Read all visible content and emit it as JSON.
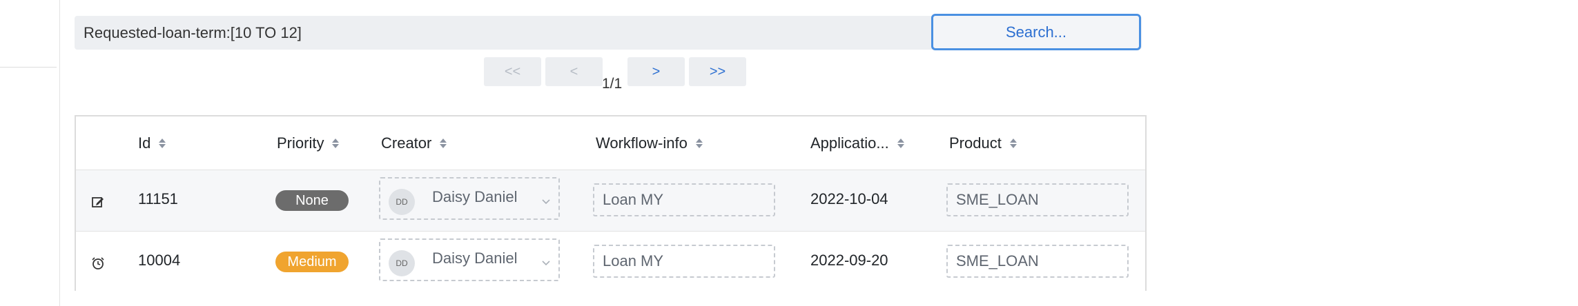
{
  "search": {
    "query": "Requested-loan-term:[10 TO 12]",
    "button_label": "Search..."
  },
  "pagination": {
    "first": "<<",
    "prev": "<",
    "next": ">",
    "last": ">>",
    "indicator": "1/1"
  },
  "table": {
    "columns": {
      "id": "Id",
      "priority": "Priority",
      "creator": "Creator",
      "workflow": "Workflow-info",
      "application": "Applicatio...",
      "product": "Product"
    },
    "rows": [
      {
        "icon": "edit-icon",
        "id": "11151",
        "priority": "None",
        "priority_color": "#6c6c6c",
        "creator_initials": "DD",
        "creator_name": "Daisy Daniel",
        "workflow": "Loan MY",
        "application_date": "2022-10-04",
        "product": "SME_LOAN"
      },
      {
        "icon": "alarm-clock-icon",
        "id": "10004",
        "priority": "Medium",
        "priority_color": "#f0a42f",
        "creator_initials": "DD",
        "creator_name": "Daisy Daniel",
        "workflow": "Loan MY",
        "application_date": "2022-09-20",
        "product": "SME_LOAN"
      }
    ]
  },
  "colors": {
    "accent": "#2c6fd1",
    "focus_border": "#4a90e2"
  }
}
